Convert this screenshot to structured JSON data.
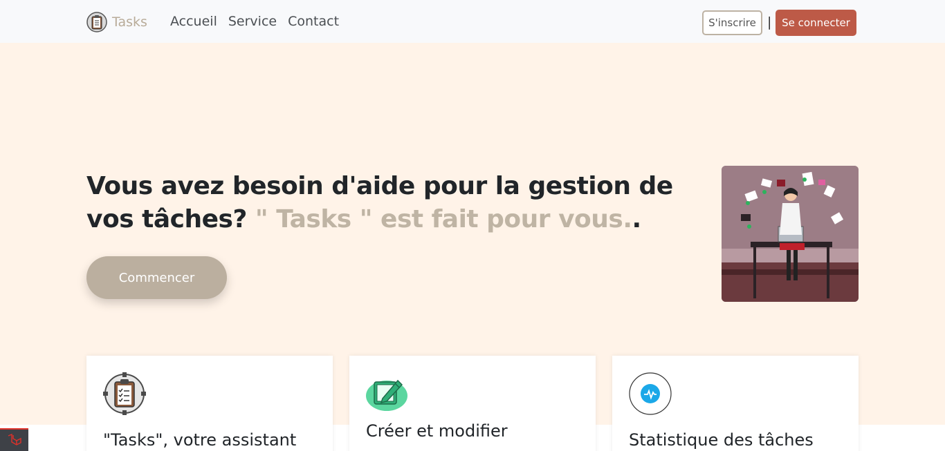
{
  "navbar": {
    "brand": "Tasks",
    "links": [
      "Accueil",
      "Service",
      "Contact"
    ],
    "signup_label": "S'inscrire",
    "separator": "|",
    "login_label": "Se connecter"
  },
  "hero": {
    "title_main": "Vous avez besoin d'aide pour la gestion de vos tâches?",
    "title_accent": "\" Tasks \" est fait pour vous.",
    "title_end": ".",
    "cta_label": "Commencer"
  },
  "cards": [
    {
      "title": "\"Tasks\", votre assistant",
      "icon": "clipboard-gear-icon"
    },
    {
      "title": "Créer et modifier",
      "icon": "edit-pencil-icon"
    },
    {
      "title": "Statistique des tâches",
      "icon": "pulse-icon"
    }
  ],
  "colors": {
    "hero_bg": "#fff3e8",
    "accent": "#bfb4a4",
    "login_button": "#bd5a47"
  }
}
